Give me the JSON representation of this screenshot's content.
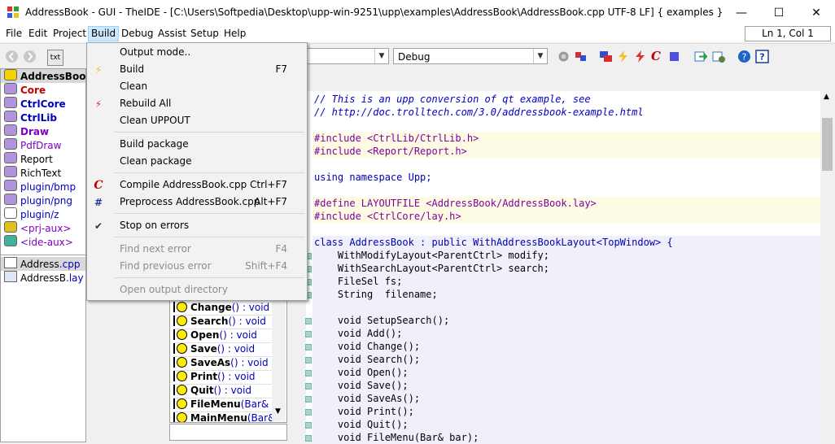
{
  "window": {
    "title": "AddressBook - GUI - TheIDE - [C:\\Users\\Softpedia\\Desktop\\upp-win-9251\\upp\\examples\\AddressBook\\AddressBook.cpp UTF-8 LF] { examples }",
    "minimize": "—",
    "maximize": "☐",
    "close": "✕"
  },
  "menubar": {
    "items": [
      "File",
      "Edit",
      "Project",
      "Build",
      "Debug",
      "Assist",
      "Setup",
      "Help"
    ]
  },
  "status": {
    "position": "Ln 1, Col 1"
  },
  "toolbar": {
    "config_combo": "Debug",
    "txt_label": "txt"
  },
  "packages": [
    {
      "name": "AddressBook",
      "color": "#000000",
      "bold": true,
      "selected": true,
      "icon_color": "#f2d400"
    },
    {
      "name": "Core",
      "color": "#c00000",
      "bold": true,
      "icon_color": "#b094e0"
    },
    {
      "name": "CtrlCore",
      "color": "#0000c0",
      "bold": true,
      "icon_color": "#b094e0"
    },
    {
      "name": "CtrlLib",
      "color": "#0000c0",
      "bold": true,
      "icon_color": "#b094e0"
    },
    {
      "name": "Draw",
      "color": "#8000c0",
      "bold": true,
      "icon_color": "#b094e0"
    },
    {
      "name": "PdfDraw",
      "color": "#8000c0",
      "bold": false,
      "icon_color": "#b094e0"
    },
    {
      "name": "Report",
      "color": "#000000",
      "bold": false,
      "icon_color": "#b094e0"
    },
    {
      "name": "RichText",
      "color": "#000000",
      "bold": false,
      "icon_color": "#b094e0"
    },
    {
      "name": "plugin/bmp",
      "color": "#0000c0",
      "bold": false,
      "icon_color": "#b094e0"
    },
    {
      "name": "plugin/png",
      "color": "#0000c0",
      "bold": false,
      "icon_color": "#b094e0"
    },
    {
      "name": "plugin/z",
      "color": "#0000c0",
      "bold": false,
      "icon_color": "#ffffff"
    },
    {
      "name": "<prj-aux>",
      "color": "#8000c0",
      "bold": false,
      "icon_color": "#e0c020"
    },
    {
      "name": "<ide-aux>",
      "color": "#8000c0",
      "bold": false,
      "icon_color": "#40b0a0"
    }
  ],
  "files": [
    {
      "name": "Address",
      "ext": ".cpp",
      "selected": true
    },
    {
      "name": "AddressB",
      "ext": ".lay",
      "selected": false
    }
  ],
  "build_menu": {
    "items": [
      {
        "label": "Output mode..",
        "shortcut": "",
        "icon": "",
        "disabled": false
      },
      {
        "label": "Build",
        "shortcut": "F7",
        "icon": "build-icon",
        "disabled": false
      },
      {
        "label": "Clean",
        "shortcut": "",
        "icon": "",
        "disabled": false
      },
      {
        "label": "Rebuild All",
        "shortcut": "",
        "icon": "rebuild-icon",
        "disabled": false
      },
      {
        "label": "Clean UPPOUT",
        "shortcut": "",
        "icon": "",
        "disabled": false
      },
      {
        "label": "Build package",
        "shortcut": "",
        "icon": "",
        "disabled": false
      },
      {
        "label": "Clean package",
        "shortcut": "",
        "icon": "",
        "disabled": false
      },
      {
        "label": "Compile AddressBook.cpp",
        "shortcut": "Ctrl+F7",
        "icon": "compile-icon",
        "disabled": false
      },
      {
        "label": "Preprocess AddressBook.cpp",
        "shortcut": "Alt+F7",
        "icon": "preprocess-icon",
        "disabled": false
      },
      {
        "label": "Stop on errors",
        "shortcut": "",
        "icon": "check-icon",
        "disabled": false
      },
      {
        "label": "Find next error",
        "shortcut": "F4",
        "icon": "",
        "disabled": true
      },
      {
        "label": "Find previous error",
        "shortcut": "Shift+F4",
        "icon": "",
        "disabled": true
      },
      {
        "label": "Open output directory",
        "shortcut": "",
        "icon": "",
        "disabled": true
      }
    ]
  },
  "navigator": {
    "items": [
      {
        "name": "Change",
        "sig": "() : void"
      },
      {
        "name": "Search",
        "sig": "() : void"
      },
      {
        "name": "Open",
        "sig": "() : void"
      },
      {
        "name": "Save",
        "sig": "() : void"
      },
      {
        "name": "SaveAs",
        "sig": "() : void"
      },
      {
        "name": "Print",
        "sig": "() : void"
      },
      {
        "name": "Quit",
        "sig": "() : void"
      },
      {
        "name": "FileMenu",
        "sig": "(Bar& b"
      },
      {
        "name": "MainMenu",
        "sig": "(Bar&"
      }
    ]
  },
  "code": [
    {
      "text": "// This is an upp conversion of qt example, see",
      "cls": "cmt"
    },
    {
      "text": "// http://doc.trolltech.com/3.0/addressbook-example.html",
      "cls": "cmt"
    },
    {
      "text": "",
      "cls": ""
    },
    {
      "text": "#include <CtrlLib/CtrlLib.h>",
      "cls": "pre"
    },
    {
      "text": "#include <Report/Report.h>",
      "cls": "pre"
    },
    {
      "text": "",
      "cls": ""
    },
    {
      "text": "using namespace Upp;",
      "cls": "kw"
    },
    {
      "text": "",
      "cls": ""
    },
    {
      "text": "#define LAYOUTFILE <AddressBook/AddressBook.lay>",
      "cls": "pre"
    },
    {
      "text": "#include <CtrlCore/lay.h>",
      "cls": "pre"
    },
    {
      "text": "",
      "cls": ""
    },
    {
      "text": "class AddressBook : public WithAddressBookLayout<TopWindow> {",
      "cls": "kw"
    },
    {
      "text": "    WithModifyLayout<ParentCtrl> modify;",
      "cls": ""
    },
    {
      "text": "    WithSearchLayout<ParentCtrl> search;",
      "cls": ""
    },
    {
      "text": "    FileSel fs;",
      "cls": ""
    },
    {
      "text": "    String  filename;",
      "cls": ""
    },
    {
      "text": "",
      "cls": ""
    },
    {
      "text": "    void SetupSearch();",
      "cls": ""
    },
    {
      "text": "    void Add();",
      "cls": ""
    },
    {
      "text": "    void Change();",
      "cls": ""
    },
    {
      "text": "    void Search();",
      "cls": ""
    },
    {
      "text": "    void Open();",
      "cls": ""
    },
    {
      "text": "    void Save();",
      "cls": ""
    },
    {
      "text": "    void SaveAs();",
      "cls": ""
    },
    {
      "text": "    void Print();",
      "cls": ""
    },
    {
      "text": "    void Quit();",
      "cls": ""
    },
    {
      "text": "    void FileMenu(Bar& bar);",
      "cls": ""
    }
  ]
}
